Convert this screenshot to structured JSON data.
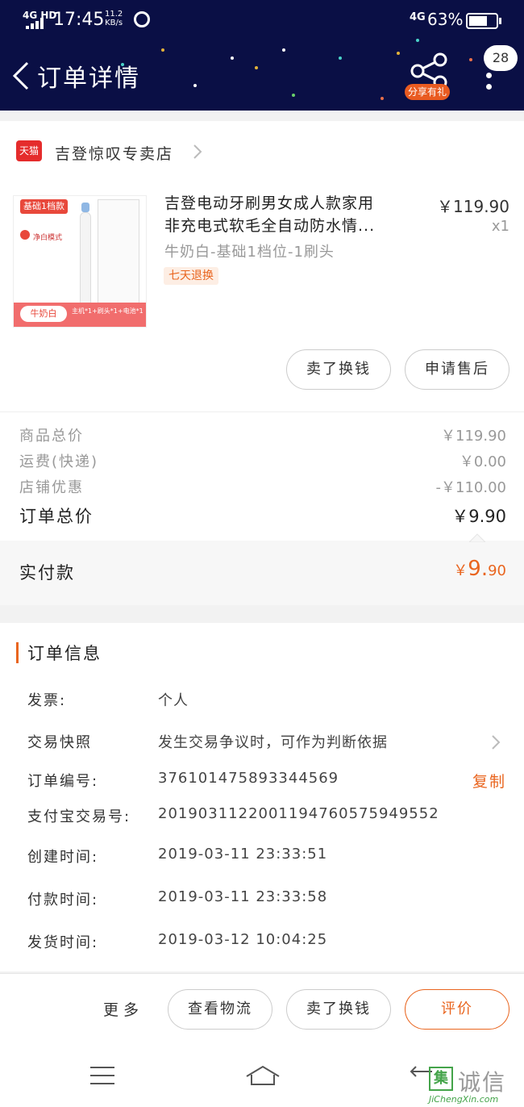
{
  "status_bar": {
    "network": "4G HD",
    "time": "17:45",
    "speed_value": "11.2",
    "speed_unit": "KB/s",
    "lte": "4G",
    "battery": "63%"
  },
  "header": {
    "title": "订单详情",
    "share_label": "分享有礼",
    "badge_count": "28"
  },
  "shop": {
    "platform": "天猫",
    "name": "吉登惊叹专卖店"
  },
  "product": {
    "image_tag": "基础1档款",
    "image_mode": "净白模式",
    "image_color": "牛奶白",
    "image_bundle": "主机*1+刷头*1+电池*1",
    "title_line1": "吉登电动牙刷男女成人款家用",
    "title_line2": "非充电式软毛全自动防水情...",
    "price": "￥119.90",
    "quantity": "x1",
    "spec": "牛奶白-基础1档位-1刷头",
    "return_tag": "七天退换",
    "btn_sell": "卖了换钱",
    "btn_after_sale": "申请售后"
  },
  "summary": {
    "goods_total_label": "商品总价",
    "goods_total": "￥119.90",
    "shipping_label": "运费(快递)",
    "shipping": "￥0.00",
    "discount_label": "店铺优惠",
    "discount": "-￥110.00",
    "order_total_label": "订单总价",
    "order_total": "￥9.90",
    "paid_label": "实付款",
    "paid_currency": "￥",
    "paid_int": "9.",
    "paid_dec": "90"
  },
  "order_info": {
    "section_title": "订单信息",
    "invoice_label": "发票:",
    "invoice_value": "个人",
    "snapshot_label": "交易快照",
    "snapshot_value": "发生交易争议时，可作为判断依据",
    "order_no_label": "订单编号:",
    "order_no": "376101475893344569",
    "copy_label": "复制",
    "alipay_label": "支付宝交易号:",
    "alipay_no": "2019031122001194760575949552",
    "created_label": "创建时间:",
    "created": "2019-03-11 23:33:51",
    "paid_label": "付款时间:",
    "paid": "2019-03-11 23:33:58",
    "shipped_label": "发货时间:",
    "shipped": "2019-03-12 10:04:25"
  },
  "actions": {
    "more": "更多",
    "logistics": "查看物流",
    "sell": "卖了换钱",
    "review": "评价"
  },
  "watermark": {
    "cn": "诚信",
    "en": "JiChengXin.com",
    "box": "集"
  },
  "colors": {
    "header_bg": "#0a0f45",
    "accent": "#e9651f",
    "tmall_red": "#e52c2c"
  }
}
